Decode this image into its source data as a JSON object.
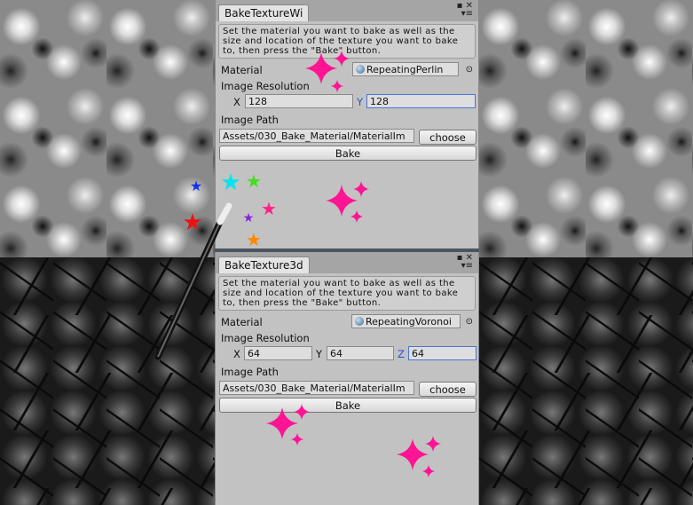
{
  "top_window": {
    "tab_title": "BakeTextureWi",
    "help_text": "Set the material you want to bake as well as the size and location of the texture you want to bake to, then press the \"Bake\" button.",
    "material_label": "Material",
    "material_value": "RepeatingPerlin",
    "resolution_label": "Image Resolution",
    "x_label": "X",
    "x_value": "128",
    "y_label": "Y",
    "y_value": "128",
    "path_label": "Image Path",
    "path_value": "Assets/030_Bake_Material/MaterialIm",
    "choose_label": "choose",
    "bake_label": "Bake"
  },
  "bottom_window": {
    "tab_title": "BakeTexture3d",
    "help_text": "Set the material you want to bake as well as the size and location of the texture you want to bake to, then press the \"Bake\" button.",
    "material_label": "Material",
    "material_value": "RepeatingVoronoi",
    "resolution_label": "Image Resolution",
    "x_label": "X",
    "x_value": "64",
    "y_label": "Y",
    "y_value": "64",
    "z_label": "Z",
    "z_value": "64",
    "path_label": "Image Path",
    "path_value": "Assets/030_Bake_Material/MaterialIm",
    "choose_label": "choose",
    "bake_label": "Bake"
  },
  "icons": {
    "window_controls": "maximize-close-icons",
    "menu": "tab-menu-icon",
    "object_picker": "object-picker-icon",
    "decoration": "magic-wand-with-stars"
  },
  "colors": {
    "panel": "#c2c2c2",
    "focus": "#4a74d8",
    "sparkle": "#ff1493"
  }
}
